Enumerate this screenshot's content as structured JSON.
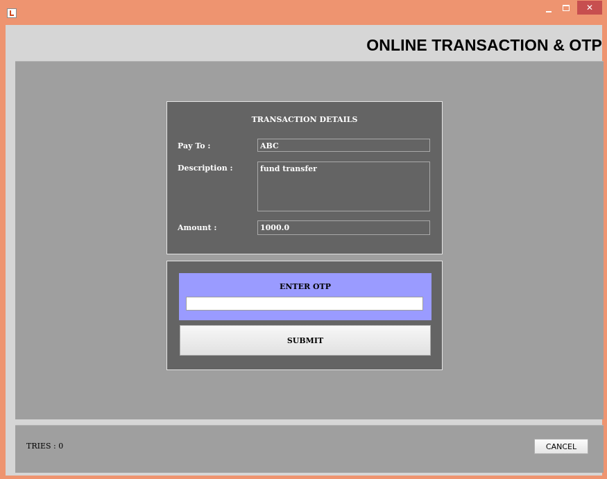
{
  "window": {
    "icon": "java-app-icon",
    "controls": {
      "minimize": "minimize-icon",
      "maximize": "maximize-icon",
      "close": "close-icon",
      "close_glyph": "✕"
    }
  },
  "header": {
    "title": "ONLINE TRANSACTION & OTP"
  },
  "transaction": {
    "title": "TRANSACTION DETAILS",
    "pay_to": {
      "label": "Pay To :",
      "value": "ABC"
    },
    "description": {
      "label": "Description :",
      "value": "fund transfer"
    },
    "amount": {
      "label": "Amount :",
      "value": "1000.0"
    }
  },
  "otp": {
    "title": "ENTER OTP",
    "value": "",
    "submit_label": "SUBMIT"
  },
  "footer": {
    "tries_text": "TRIES : 0",
    "cancel_label": "CANCEL"
  },
  "colors": {
    "titlebar": "#ee9470",
    "window_bg": "#d6d6d6",
    "panel_bg": "#9f9f9f",
    "card_bg": "#646464",
    "otp_accent": "#9a9bff",
    "close_button": "#c74f4f"
  }
}
